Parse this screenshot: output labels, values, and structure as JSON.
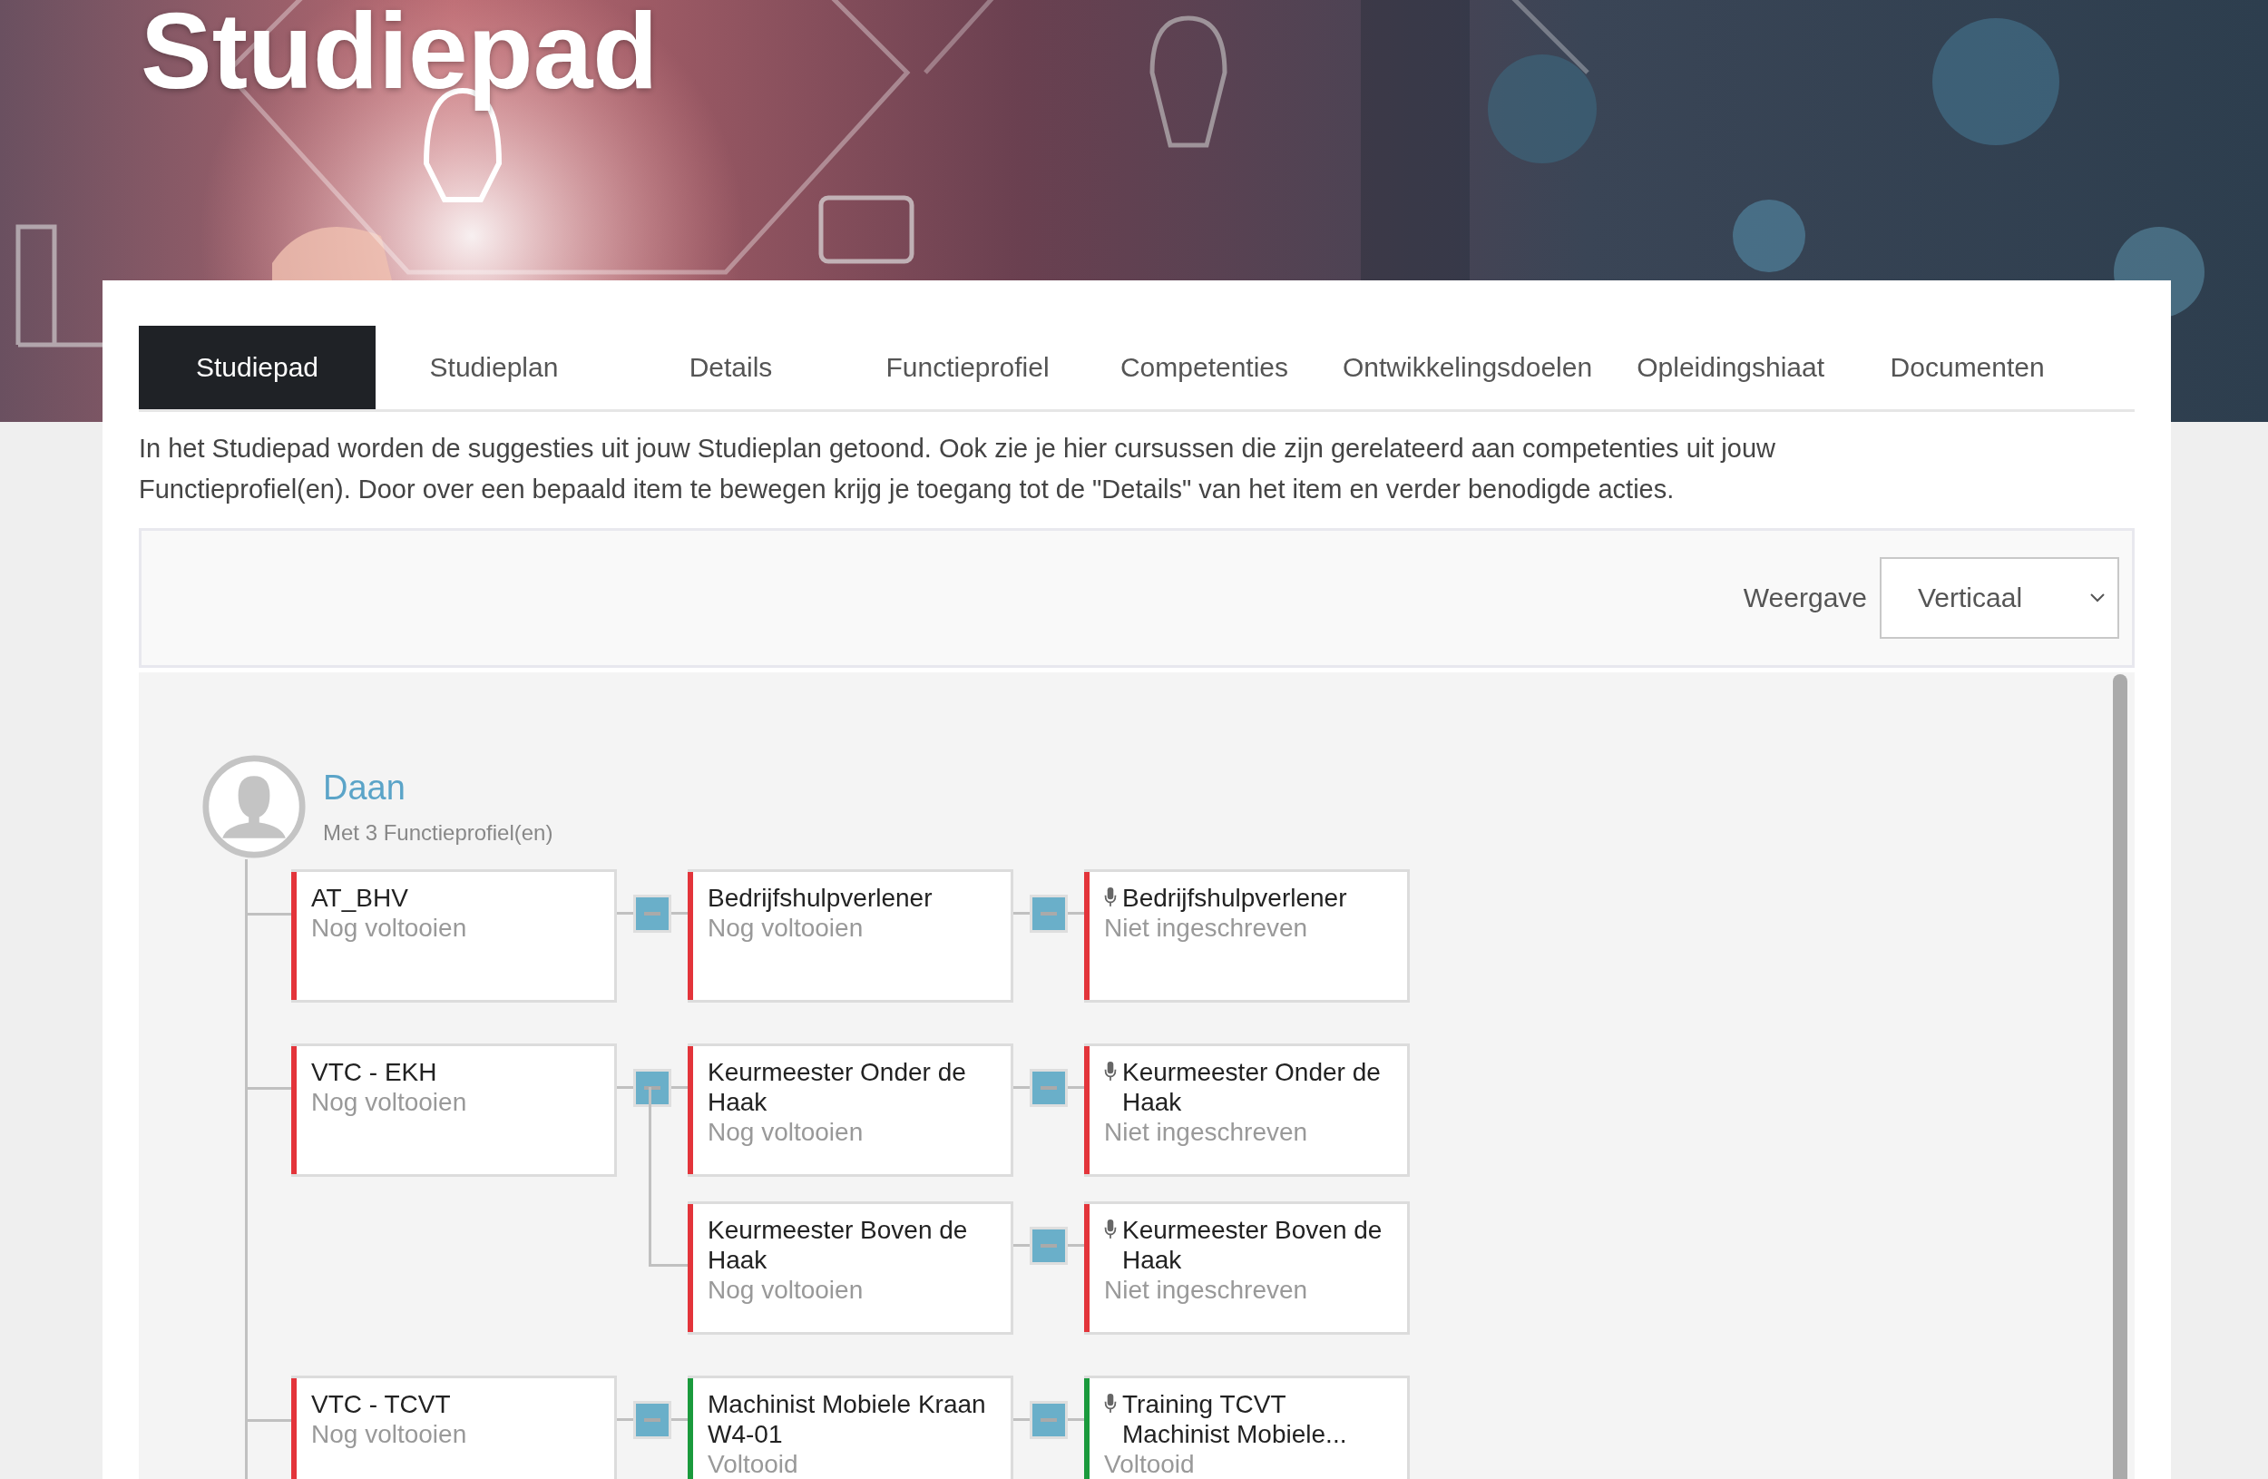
{
  "banner": {
    "title": "Studiepad"
  },
  "tabs": [
    {
      "label": "Studiepad",
      "selected": true
    },
    {
      "label": "Studieplan",
      "selected": false
    },
    {
      "label": "Details",
      "selected": false
    },
    {
      "label": "Functieprofiel",
      "selected": false
    },
    {
      "label": "Competenties",
      "selected": false
    },
    {
      "label": "Ontwikkelingsdoelen",
      "selected": false
    },
    {
      "label": "Opleidingshiaat",
      "selected": false
    },
    {
      "label": "Documenten",
      "selected": false
    }
  ],
  "intro": "In het Studiepad worden de suggesties uit jouw Studieplan getoond. Ook zie je hier cursussen die zijn gerelateerd aan competenties uit jouw Functieprofiel(en). Door over een bepaald item te bewegen krijg je toegang tot de \"Details\" van het item en verder benodigde acties.",
  "toolbar": {
    "label": "Weergave",
    "value": "Verticaal"
  },
  "person": {
    "name": "Daan",
    "subtitle": "Met 3 Functieprofiel(en)"
  },
  "profiles": [
    {
      "title": "AT_BHV",
      "status": "Nog voltooien",
      "color": "#e3343a",
      "expanded": true,
      "children": [
        {
          "title": "Bedrijfshulpverlener",
          "status": "Nog voltooien",
          "color": "#e3343a",
          "expanded": true,
          "children": [
            {
              "title": "Bedrijfshulpverlener",
              "status": "Niet ingeschreven",
              "color": "#e3343a"
            }
          ]
        }
      ]
    },
    {
      "title": "VTC - EKH",
      "status": "Nog voltooien",
      "color": "#e3343a",
      "expanded": true,
      "children": [
        {
          "title": "Keurmeester Onder de Haak",
          "status": "Nog voltooien",
          "color": "#e3343a",
          "expanded": true,
          "children": [
            {
              "title": "Keurmeester Onder de Haak",
              "status": "Niet ingeschreven",
              "color": "#e3343a"
            }
          ]
        },
        {
          "title": "Keurmeester Boven de Haak",
          "status": "Nog voltooien",
          "color": "#e3343a",
          "expanded": true,
          "children": [
            {
              "title": "Keurmeester Boven de Haak",
              "status": "Niet ingeschreven",
              "color": "#e3343a"
            }
          ]
        }
      ]
    },
    {
      "title": "VTC - TCVT",
      "status": "Nog voltooien",
      "color": "#e3343a",
      "expanded": true,
      "children": [
        {
          "title": "Machinist Mobiele Kraan W4-01",
          "status": "Voltooid",
          "color": "#1a9a3c",
          "expanded": true,
          "children": [
            {
              "title": "Training TCVT Machinist Mobiele...",
              "status": "Voltooid",
              "color": "#1a9a3c"
            }
          ]
        }
      ]
    }
  ]
}
